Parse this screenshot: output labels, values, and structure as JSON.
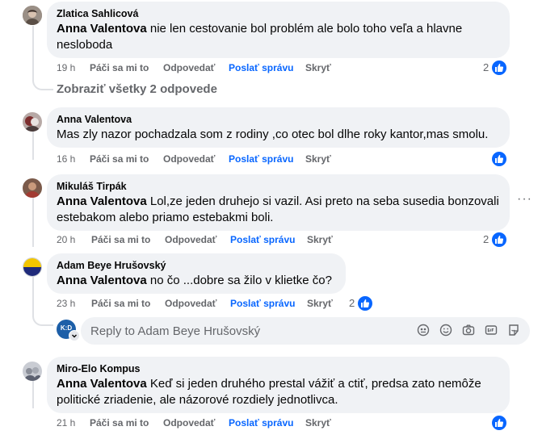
{
  "comments": [
    {
      "author": "Zlatica Sahlicová",
      "mention": "Anna Valentova",
      "text": " nie len cestovanie bol problém ale bolo toho veľa a hlavne nesloboda",
      "time": "19 h",
      "like_label": "Páči sa mi to",
      "reply_label": "Odpovedať",
      "message_label": "Poslať správu",
      "hide_label": "Skryť",
      "reaction_count": "2"
    },
    {
      "author": "Anna Valentova",
      "mention": "",
      "text": "Mas zly nazor pochadzala som z rodiny ,co otec bol dlhe roky kantor,mas smolu.",
      "time": "16 h",
      "like_label": "Páči sa mi to",
      "reply_label": "Odpovedať",
      "message_label": "Poslať správu",
      "hide_label": "Skryť",
      "reaction_count": ""
    },
    {
      "author": "Mikuláš Tirpák",
      "mention": "Anna Valentova",
      "text": " Lol,ze jeden druhejo si vazil. Asi preto na seba susedia bonzovali estebakom alebo priamo estebakmi boli.",
      "time": "20 h",
      "like_label": "Páči sa mi to",
      "reply_label": "Odpovedať",
      "message_label": "Poslať správu",
      "hide_label": "Skryť",
      "reaction_count": "2"
    },
    {
      "author": "Adam Beye Hrušovský",
      "mention": "Anna Valentova",
      "text": " no čo ...dobre sa žilo v klietke čo?",
      "time": "23 h",
      "like_label": "Páči sa mi to",
      "reply_label": "Odpovedať",
      "message_label": "Poslať správu",
      "hide_label": "Skryť",
      "reaction_count": "2"
    },
    {
      "author": "Miro-Elo Kompus",
      "mention": "Anna Valentova",
      "text": " Keď si jeden druhého prestal vážiť a ctiť, predsa zato nemôže politické zriadenie, ale názorové rozdiely jednotlivca.",
      "time": "21 h",
      "like_label": "Páči sa mi to",
      "reply_label": "Odpovedať",
      "message_label": "Poslať správu",
      "hide_label": "Skryť",
      "reaction_count": ""
    }
  ],
  "view_replies": "Zobraziť všetky 2 odpovede",
  "reply_box": {
    "placeholder": "Reply to Adam Beye Hrušovský",
    "avatar_initials": "K:D"
  },
  "more_options": "···",
  "colors": {
    "bubble": "#f0f2f5",
    "link": "#0866ff",
    "meta": "#65676b",
    "thread_line": "#dfe1e5"
  },
  "icons": {
    "like": "thumbs-up-icon",
    "emoji": "smiley-icon",
    "avatar_sticker": "avatar-icon",
    "camera": "camera-icon",
    "gif": "gif-icon",
    "sticker": "sticker-icon"
  }
}
